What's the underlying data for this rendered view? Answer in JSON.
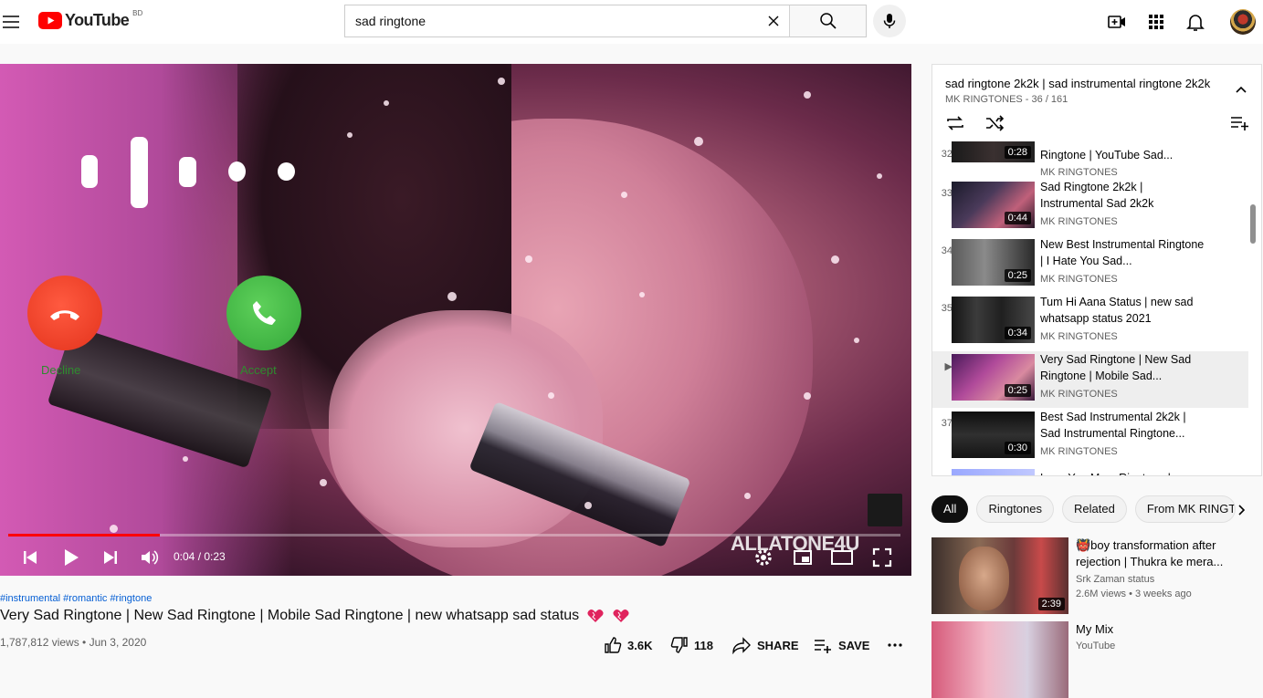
{
  "header": {
    "logo_text": "YouTube",
    "country_code": "BD",
    "search_query": "sad ringtone",
    "icons": [
      "menu-icon",
      "create-video-icon",
      "apps-icon",
      "notifications-icon"
    ]
  },
  "player": {
    "time_current": "0:04",
    "time_total": "0:23",
    "time_display": "0:04 / 0:23",
    "progress": 0.17,
    "watermark": "ALLATONE4U",
    "decline_label": "Decline",
    "accept_label": "Accept"
  },
  "video": {
    "hashtags": "#instrumental #romantic #ringtone",
    "title": "Very Sad Ringtone | New Sad Ringtone | Mobile Sad Ringtone | new whatsapp sad status",
    "views_date": "1,787,812 views • Jun 3, 2020",
    "likes": "3.6K",
    "dislikes": "118",
    "share_label": "SHARE",
    "save_label": "SAVE"
  },
  "playlist": {
    "title": "sad ringtone 2k2k | sad instrumental ringtone 2k2k",
    "subtitle": "MK RINGTONES - 36 / 161",
    "items": [
      {
        "index": "32",
        "title": "Ringtone | YouTube Sad...",
        "channel": "MK RINGTONES",
        "duration": "0:28"
      },
      {
        "index": "33",
        "title": "Sad Ringtone 2k2k | Instrumental Sad 2k2k",
        "channel": "MK RINGTONES",
        "duration": "0:44"
      },
      {
        "index": "34",
        "title": "New Best Instrumental Ringtone | I Hate You Sad...",
        "channel": "MK RINGTONES",
        "duration": "0:25"
      },
      {
        "index": "35",
        "title": "Tum Hi Aana Status | new sad whatsapp status 2021",
        "channel": "MK RINGTONES",
        "duration": "0:34"
      },
      {
        "index": "▶",
        "title": "Very Sad Ringtone | New Sad Ringtone | Mobile Sad...",
        "channel": "MK RINGTONES",
        "duration": "0:25"
      },
      {
        "index": "37",
        "title": "Best Sad Instrumental 2k2k | Sad Instrumental Ringtone...",
        "channel": "MK RINGTONES",
        "duration": "0:30"
      },
      {
        "index": "",
        "title": "Love You Mom Ringtone |",
        "channel": "",
        "duration": ""
      }
    ]
  },
  "chips": [
    "All",
    "Ringtones",
    "Related",
    "From MK RINGT"
  ],
  "related": [
    {
      "title": "👹boy transformation after rejection | Thukra ke mera...",
      "channel": "Srk Zaman status",
      "meta": "2.6M views • 3 weeks ago",
      "duration": "2:39"
    },
    {
      "title": "My Mix",
      "channel": "YouTube",
      "meta": "",
      "duration": ""
    }
  ],
  "colors": {
    "brand_red": "#FF0000",
    "link_blue": "#065fd4",
    "heart": "#e0245e"
  }
}
